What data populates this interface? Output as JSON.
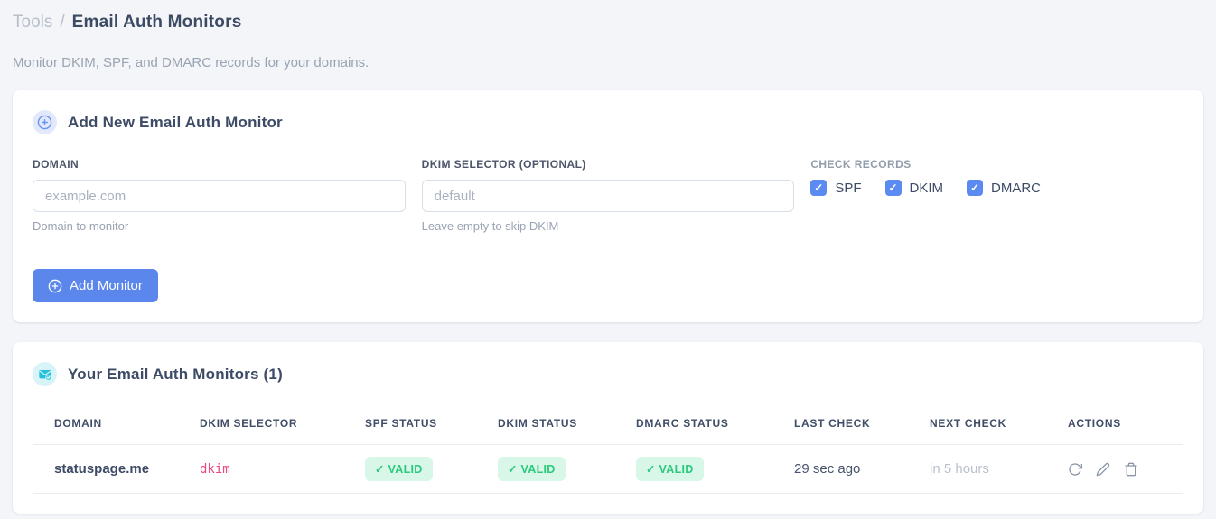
{
  "breadcrumb": {
    "section": "Tools",
    "separator": "/",
    "page": "Email Auth Monitors"
  },
  "subtitle": "Monitor DKIM, SPF, and DMARC records for your domains.",
  "add_card": {
    "title": "Add New Email Auth Monitor",
    "fields": {
      "domain": {
        "label": "DOMAIN",
        "placeholder": "example.com",
        "hint": "Domain to monitor"
      },
      "dkim_selector": {
        "label": "DKIM SELECTOR (OPTIONAL)",
        "placeholder": "default",
        "hint": "Leave empty to skip DKIM"
      }
    },
    "check_records": {
      "label": "CHECK RECORDS",
      "check_glyph": "✓",
      "options": [
        {
          "label": "SPF",
          "checked": true
        },
        {
          "label": "DKIM",
          "checked": true
        },
        {
          "label": "DMARC",
          "checked": true
        }
      ]
    },
    "submit_label": "Add Monitor"
  },
  "monitors_card": {
    "title": "Your Email Auth Monitors (1)",
    "table": {
      "headers": [
        "DOMAIN",
        "DKIM SELECTOR",
        "SPF STATUS",
        "DKIM STATUS",
        "DMARC STATUS",
        "LAST CHECK",
        "NEXT CHECK",
        "ACTIONS"
      ],
      "rows": [
        {
          "domain": "statuspage.me",
          "dkim_selector": "dkim",
          "spf_status": "✓ VALID",
          "dkim_status": "✓ VALID",
          "dmarc_status": "✓ VALID",
          "last_check": "29 sec ago",
          "next_check": "in 5 hours"
        }
      ]
    },
    "icons": {
      "actions": [
        "refresh-icon",
        "edit-icon",
        "delete-icon"
      ]
    }
  },
  "colors": {
    "accent_blue": "#5b87ec",
    "checkbox_blue": "#5b8bf0",
    "badge_green_bg": "#d9f7e9",
    "badge_green_text": "#2bc97c",
    "selector_pink": "#ed4a7e",
    "teal_icon": "#23c2da",
    "page_bg": "#f3f5f8"
  }
}
